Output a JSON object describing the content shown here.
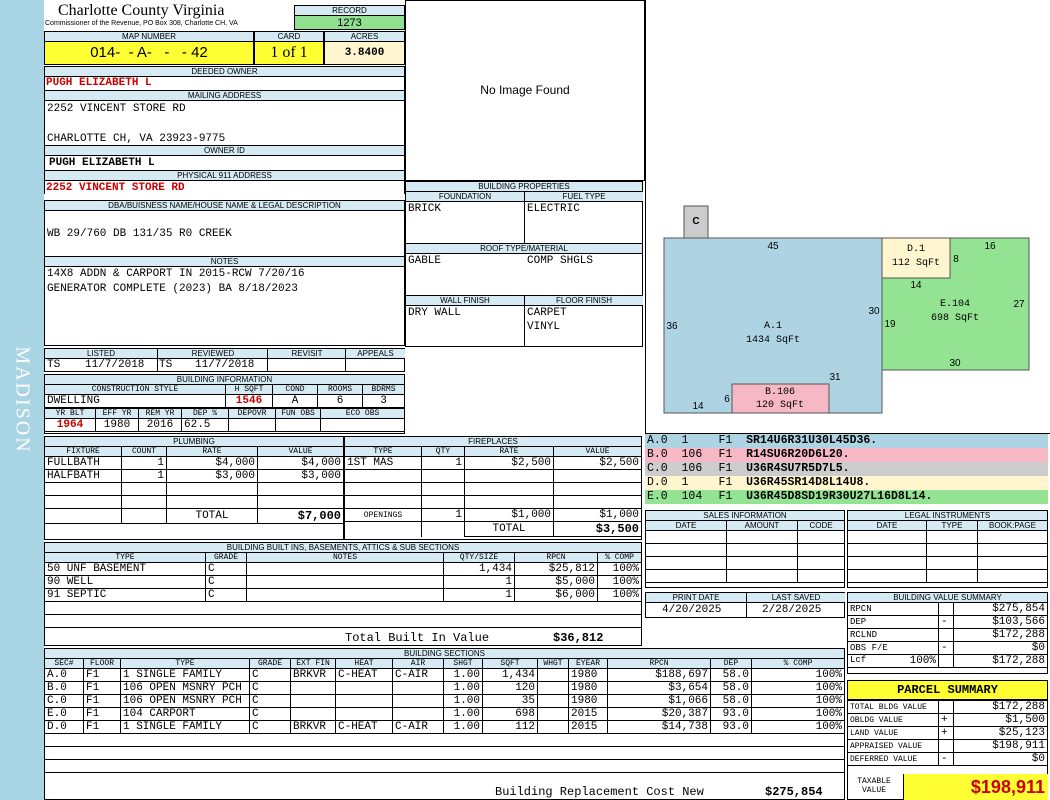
{
  "sidebar": {
    "district": "MADISON"
  },
  "header": {
    "county": "Charlotte County Virginia",
    "commissioner": "Commissioner of the Revenue, PO Box 308, Charlotte CH, VA",
    "record_label": "RECORD",
    "record_value": "1273",
    "map_number_label": "MAP NUMBER",
    "map_number": "014-  - A-   -   - 42",
    "card_label": "CARD",
    "card": "1 of 1",
    "acres_label": "ACRES",
    "acres": "3.8400"
  },
  "owner": {
    "deeded_label": "DEEDED OWNER",
    "deeded": "PUGH ELIZABETH L",
    "mailing_label": "MAILING ADDRESS",
    "mailing_line1": "2252 VINCENT STORE RD",
    "mailing_line2": "",
    "mailing_line3": "CHARLOTTE CH, VA 23923-9775",
    "owner_id_label": "OWNER ID",
    "owner_id": "PUGH ELIZABETH L",
    "physical_label": "PHYSICAL 911 ADDRESS",
    "physical": "2252 VINCENT STORE RD",
    "legal_label": "DBA/BUISNESS NAME/HOUSE NAME & LEGAL DESCRIPTION",
    "legal": "WB 29/760 DB 131/35 R0 CREEK",
    "notes_label": "NOTES",
    "notes_line1": "14X8 ADDN & CARPORT IN 2015-RCW 7/20/16",
    "notes_line2": "GENERATOR COMPLETE (2023) BA 8/18/2023"
  },
  "image": {
    "placeholder": "No Image Found"
  },
  "building_properties": {
    "title": "BUILDING PROPERTIES",
    "foundation_label": "FOUNDATION",
    "foundation": "BRICK",
    "fuel_label": "FUEL TYPE",
    "fuel": "ELECTRIC",
    "roof_label": "ROOF TYPE/MATERIAL",
    "roof_type": "GABLE",
    "roof_material": "COMP SHGLS",
    "wall_label": "WALL FINISH",
    "wall": "DRY WALL",
    "floor_label": "FLOOR FINISH",
    "floor1": "CARPET",
    "floor2": "VINYL"
  },
  "listing": {
    "listed_label": "LISTED",
    "listed_by": "TS",
    "listed_date": "11/7/2018",
    "reviewed_label": "REVIEWED",
    "reviewed_by": "TS",
    "reviewed_date": "11/7/2018",
    "revisit_label": "REVISIT",
    "appeals_label": "APPEALS"
  },
  "building_info": {
    "title": "BUILDING INFORMATION",
    "style_label": "CONSTRUCTION STYLE",
    "style": "DWELLING",
    "hsqft_label": "H SQFT",
    "hsqft": "1546",
    "cond_label": "COND",
    "cond": "A",
    "rooms_label": "ROOMS",
    "rooms": "6",
    "bdrms_label": "BDRMS",
    "bdrms": "3",
    "yrblt_label": "YR BLT",
    "yrblt": "1964",
    "effyr_label": "EFF YR",
    "effyr": "1980",
    "remyr_label": "REM YR",
    "remyr": "2016",
    "dep_label": "DEP %",
    "dep": "62.5",
    "depovr_label": "DEPOVR",
    "funobs_label": "FUN OBS",
    "ecoobs_label": "ECO OBS"
  },
  "plumbing": {
    "title": "PLUMBING",
    "headers": [
      "FIXTURE",
      "COUNT",
      "RATE",
      "VALUE"
    ],
    "rows": [
      [
        "FULLBATH",
        "1",
        "$4,000",
        "$4,000"
      ],
      [
        "HALFBATH",
        "1",
        "$3,000",
        "$3,000"
      ]
    ],
    "total_label": "TOTAL",
    "total": "$7,000"
  },
  "fireplaces": {
    "title": "FIREPLACES",
    "headers": [
      "TYPE",
      "QTY",
      "RATE",
      "VALUE"
    ],
    "rows": [
      [
        "1ST MAS",
        "1",
        "$2,500",
        "$2,500"
      ]
    ],
    "openings_label": "OPENINGS",
    "openings_qty": "1",
    "openings_rate": "$1,000",
    "openings_value": "$1,000",
    "total_label": "TOTAL",
    "total": "$3,500"
  },
  "builtins": {
    "title": "BUILDING BUILT INS, BASEMENTS, ATTICS & SUB SECTIONS",
    "headers": [
      "TYPE",
      "GRADE",
      "NOTES",
      "QTY/SIZE",
      "RPCN",
      "% COMP"
    ],
    "rows": [
      [
        "50 UNF BASEMENT",
        "C",
        "",
        "1,434",
        "$25,812",
        "100%"
      ],
      [
        "90 WELL",
        "C",
        "",
        "1",
        "$5,000",
        "100%"
      ],
      [
        "91 SEPTIC",
        "C",
        "",
        "1",
        "$6,000",
        "100%"
      ]
    ],
    "total_label": "Total Built In Value",
    "total": "$36,812"
  },
  "sections": {
    "title": "BUILDING SECTIONS",
    "headers": [
      "SEC#",
      "FLOOR",
      "TYPE",
      "GRADE",
      "EXT FIN",
      "HEAT",
      "AIR",
      "SHGT",
      "SQFT",
      "WHGT",
      "EYEAR",
      "RPCN",
      "DEP",
      "% COMP"
    ],
    "rows": [
      [
        "A.0",
        "F1",
        "1 SINGLE FAMILY",
        "C",
        "BRKVR",
        "C-HEAT",
        "C-AIR",
        "1.00",
        "1,434",
        "",
        "1980",
        "$188,697",
        "58.0",
        "100%"
      ],
      [
        "B.0",
        "F1",
        "106 OPEN MSNRY PCH",
        "C",
        "",
        "",
        "",
        "1.00",
        "120",
        "",
        "1980",
        "$3,654",
        "58.0",
        "100%"
      ],
      [
        "C.0",
        "F1",
        "106 OPEN MSNRY PCH",
        "C",
        "",
        "",
        "",
        "1.00",
        "35",
        "",
        "1980",
        "$1,066",
        "58.0",
        "100%"
      ],
      [
        "E.0",
        "F1",
        "104 CARPORT",
        "C",
        "",
        "",
        "",
        "1.00",
        "698",
        "",
        "2015",
        "$20,387",
        "93.0",
        "100%"
      ],
      [
        "D.0",
        "F1",
        "1 SINGLE FAMILY",
        "C",
        "BRKVR",
        "C-HEAT",
        "C-AIR",
        "1.00",
        "112",
        "",
        "2015",
        "$14,738",
        "93.0",
        "100%"
      ]
    ],
    "rcn_label": "Building Replacement Cost New",
    "rcn": "$275,854"
  },
  "sketch": {
    "c_label": "C",
    "a_label": "A.1",
    "a_sqft": "1434 SqFt",
    "b_label": "B.106",
    "b_sqft": "120 SqFt",
    "d_label": "D.1",
    "d_sqft": "112 SqFt",
    "e_label": "E.104",
    "e_sqft": "698 SqFt",
    "dims": [
      "45",
      "16",
      "8",
      "14",
      "27",
      "30",
      "19",
      "36",
      "31",
      "30",
      "6",
      "14"
    ]
  },
  "sketch_codes": [
    {
      "sec": "A.0",
      "n": "1",
      "f": "F1",
      "code": "SR14U6R31U30L45D36.",
      "color": "#aed4e4"
    },
    {
      "sec": "B.0",
      "n": "106",
      "f": "F1",
      "code": "R14SU6R20D6L20.",
      "color": "#f5b8c4"
    },
    {
      "sec": "C.0",
      "n": "106",
      "f": "F1",
      "code": "U36R4SU7R5D7L5.",
      "color": "#cccccc"
    },
    {
      "sec": "D.0",
      "n": "1",
      "f": "F1",
      "code": "U36R45SR14D8L14U8.",
      "color": "#fff6d0"
    },
    {
      "sec": "E.0",
      "n": "104",
      "f": "F1",
      "code": "U36R45D8SD19R30U27L16D8L14.",
      "color": "#93e393"
    }
  ],
  "sales": {
    "title": "SALES INFORMATION",
    "headers": [
      "DATE",
      "AMOUNT",
      "CODE"
    ]
  },
  "legal_instruments": {
    "title": "LEGAL INSTRUMENTS",
    "headers": [
      "DATE",
      "TYPE",
      "BOOK:PAGE"
    ]
  },
  "dates": {
    "print_label": "PRINT DATE",
    "print_date": "4/20/2025",
    "saved_label": "LAST SAVED",
    "saved_date": "2/28/2025"
  },
  "value_summary": {
    "title": "BUILDING VALUE SUMMARY",
    "rows": [
      {
        "label": "RPCN",
        "sign": "",
        "value": "$275,854"
      },
      {
        "label": "DEP",
        "sign": "-",
        "value": "$103,566"
      },
      {
        "label": "RCLND",
        "sign": "",
        "value": "$172,288"
      },
      {
        "label": "OBS F/E",
        "sign": "-",
        "value": "$0"
      },
      {
        "label": "Lcf",
        "pct": "100%",
        "sign": "",
        "value": "$172,288"
      }
    ]
  },
  "parcel_summary": {
    "title": "PARCEL SUMMARY",
    "rows": [
      {
        "label": "TOTAL BLDG VALUE",
        "sign": "",
        "value": "$172,288"
      },
      {
        "label": "OBLDG VALUE",
        "sign": "+",
        "value": "$1,500"
      },
      {
        "label": "LAND VALUE",
        "sign": "+",
        "value": "$25,123"
      },
      {
        "label": "APPRAISED VALUE",
        "sign": "",
        "value": "$198,911"
      },
      {
        "label": "DEFERRED VALUE",
        "sign": "-",
        "value": "$0"
      }
    ],
    "taxable_label": "TAXABLE VALUE",
    "taxable_value": "$198,911"
  }
}
